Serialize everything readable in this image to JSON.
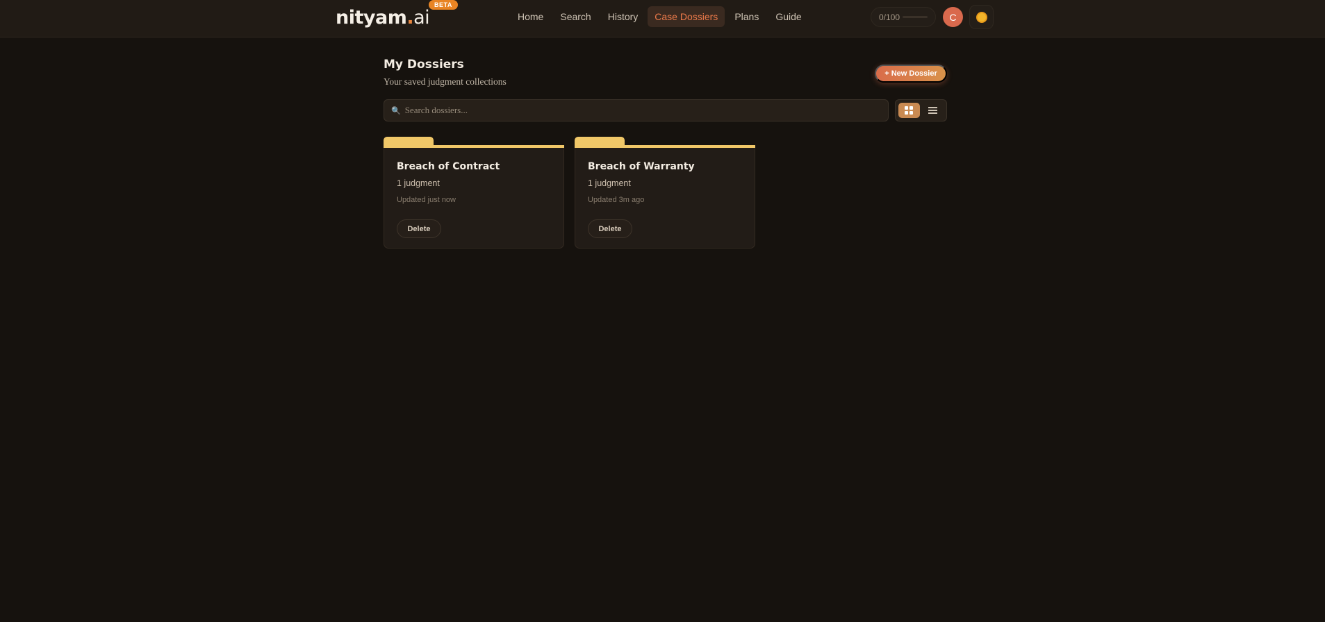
{
  "header": {
    "logo": {
      "name": "nityam",
      "dot": ".",
      "suffix": "ai",
      "badge": "BETA"
    },
    "nav": [
      {
        "label": "Home"
      },
      {
        "label": "Search"
      },
      {
        "label": "History"
      },
      {
        "label": "Case Dossiers",
        "active": true
      },
      {
        "label": "Plans"
      },
      {
        "label": "Guide"
      }
    ],
    "credits": "0/100",
    "avatar_initial": "C",
    "theme_icon": "sun-icon"
  },
  "main": {
    "title": "My Dossiers",
    "subtitle": "Your saved judgment collections",
    "new_button": "+ New Dossier",
    "search": {
      "placeholder": "Search dossiers...",
      "value": ""
    },
    "view": "grid",
    "dossiers": [
      {
        "title": "Breach of Contract",
        "count": "1 judgment",
        "updated": "Updated just now",
        "delete_label": "Delete"
      },
      {
        "title": "Breach of Warranty",
        "count": "1 judgment",
        "updated": "Updated 3m ago",
        "delete_label": "Delete"
      }
    ]
  },
  "colors": {
    "background": "#16120e",
    "accent": "#ec7a4a",
    "folder_tab": "#f0c768",
    "beta_badge": "#e88424"
  }
}
